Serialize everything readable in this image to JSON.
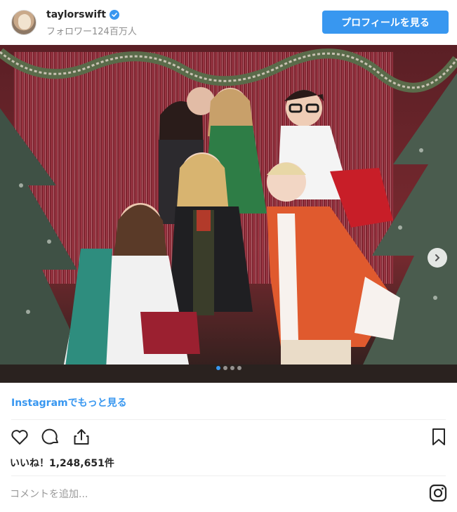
{
  "header": {
    "username": "taylorswift",
    "verified": true,
    "followers": "フォロワー124百万人",
    "profile_button": "プロフィールを見る"
  },
  "photo": {
    "carousel_dots": 4,
    "active_dot": 0,
    "next_icon": "chevron-right-icon"
  },
  "footer": {
    "more_link": "Instagramでもっと見る",
    "likes": "いいね！1,248,651件",
    "comment_placeholder": "コメントを追加...",
    "icons": [
      "heart-icon",
      "comment-icon",
      "share-icon",
      "bookmark-icon",
      "instagram-logo-icon"
    ]
  },
  "colors": {
    "accent": "#3897f0",
    "text": "#262626",
    "muted": "#8e8e8e"
  }
}
